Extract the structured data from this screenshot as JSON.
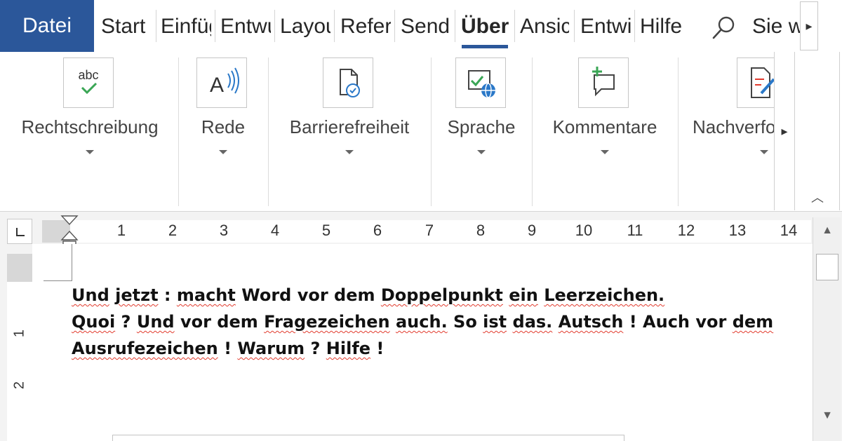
{
  "tabs": {
    "file": "Datei",
    "items": [
      {
        "label": "Start"
      },
      {
        "label": "Einfügen"
      },
      {
        "label": "Entwurf"
      },
      {
        "label": "Layout"
      },
      {
        "label": "Referenzen"
      },
      {
        "label": "Sendungen"
      },
      {
        "label": "Überprüfen"
      },
      {
        "label": "Ansicht"
      },
      {
        "label": "Entwicklertools"
      },
      {
        "label": "Hilfe"
      }
    ],
    "active": "Überprüfen",
    "tell_me": "Sie wünschen...",
    "scroll_right": "▸"
  },
  "ribbon": {
    "groups": [
      {
        "label": "Rechtschreibung",
        "icon": "spelling-icon",
        "icon_text": "abc"
      },
      {
        "label": "Rede",
        "icon": "read-aloud-icon",
        "icon_text": "A"
      },
      {
        "label": "Barrierefreiheit",
        "icon": "accessibility-icon"
      },
      {
        "label": "Sprache",
        "icon": "language-icon"
      },
      {
        "label": "Kommentare",
        "icon": "new-comment-icon"
      },
      {
        "label": "Nachverfolgung",
        "icon": "track-changes-icon"
      }
    ],
    "scroll_right": "▸",
    "collapse": "︿"
  },
  "ruler": {
    "numbers": [
      "1",
      "2",
      "3",
      "4",
      "5",
      "6",
      "7",
      "8",
      "9",
      "10",
      "11",
      "12",
      "13",
      "14"
    ],
    "vertical_numbers": [
      "1",
      "2"
    ]
  },
  "document": {
    "lines": [
      [
        {
          "t": "Und",
          "sq": true
        },
        {
          "t": " "
        },
        {
          "t": "jetzt",
          "sq": true
        },
        {
          "t": " : "
        },
        {
          "t": "macht",
          "sq": true
        },
        {
          "t": " Word vor dem "
        },
        {
          "t": "Doppelpunkt",
          "sq": true
        },
        {
          "t": " "
        },
        {
          "t": "ein",
          "sq": true
        },
        {
          "t": " "
        },
        {
          "t": "Leerzeichen.",
          "sq": true
        }
      ],
      [
        {
          "t": "Quoi",
          "sq": true
        },
        {
          "t": " ? "
        },
        {
          "t": "Und",
          "sq": true
        },
        {
          "t": " vor dem "
        },
        {
          "t": "Fragezeichen",
          "sq": true
        },
        {
          "t": " "
        },
        {
          "t": "auch.",
          "sq": true
        },
        {
          "t": " So "
        },
        {
          "t": "ist",
          "sq": true
        },
        {
          "t": " "
        },
        {
          "t": "das.",
          "sq": true
        },
        {
          "t": " "
        },
        {
          "t": "Autsch",
          "sq": true
        },
        {
          "t": " ! Auch vor "
        },
        {
          "t": "dem",
          "sq": true
        }
      ],
      [
        {
          "t": "Ausrufezeichen",
          "sq": true
        },
        {
          "t": " ! "
        },
        {
          "t": "Warum",
          "sq": true
        },
        {
          "t": " ? "
        },
        {
          "t": "Hilfe",
          "sq": true
        },
        {
          "t": " !"
        }
      ]
    ]
  },
  "scrollbar": {
    "up": "▲",
    "down": "▼"
  },
  "colors": {
    "accent": "#2b579a",
    "spell_error": "#e23b2e",
    "check_green": "#3aa655",
    "info_blue": "#2a78c8"
  }
}
